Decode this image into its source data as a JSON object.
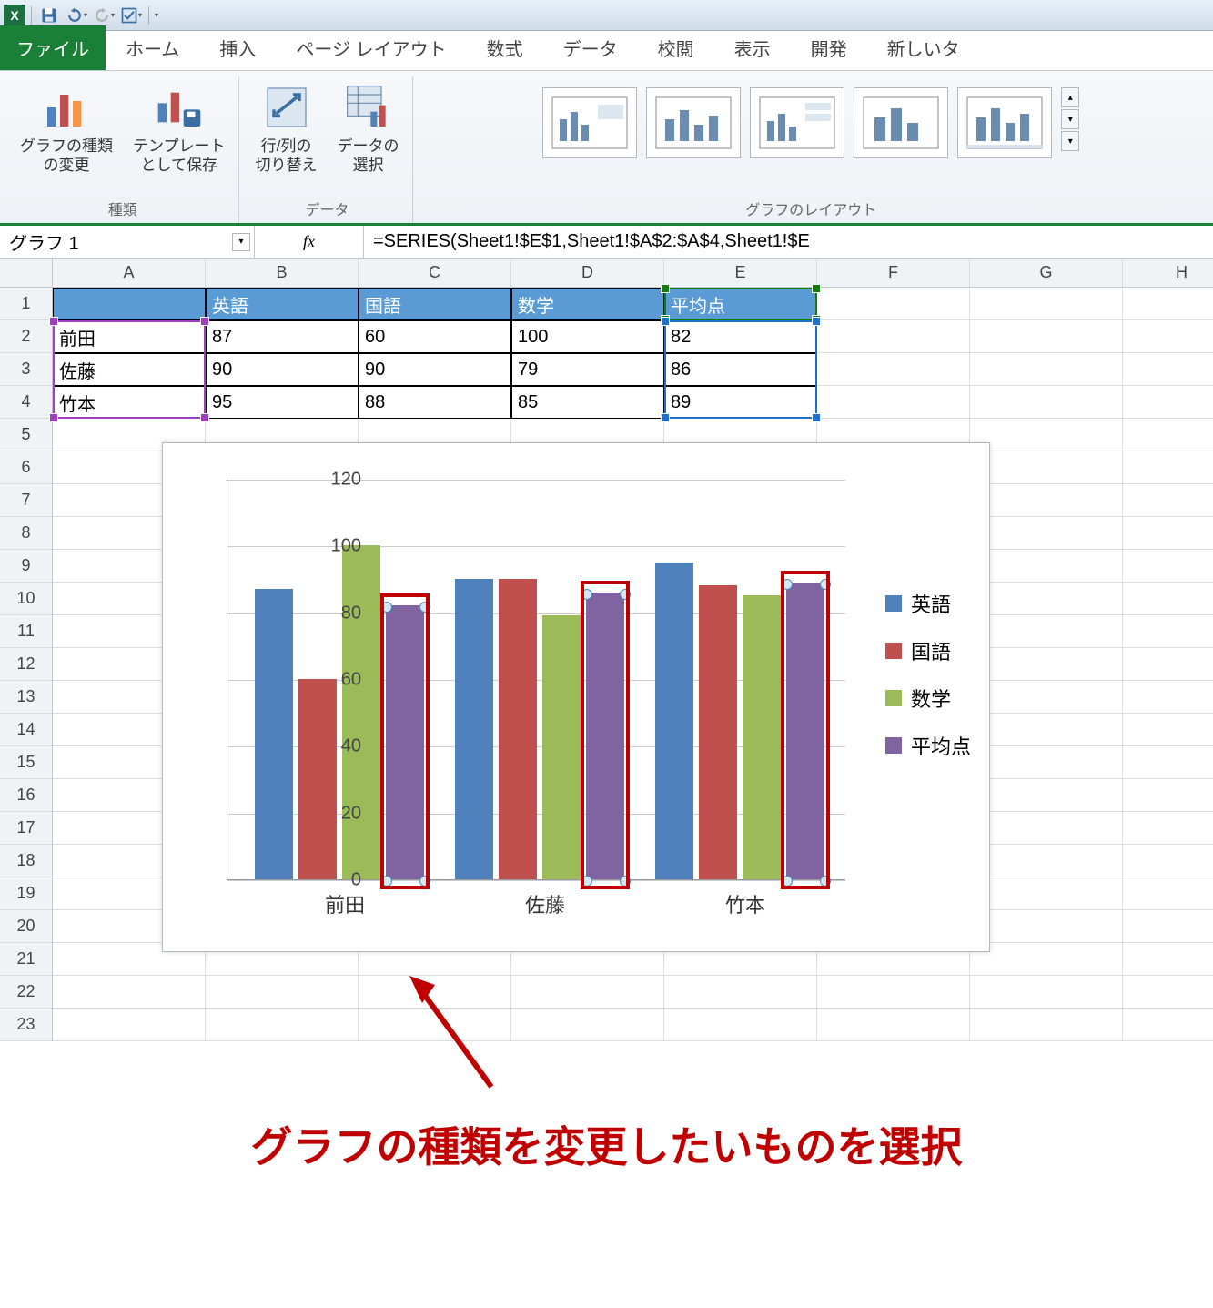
{
  "qat": {
    "excel": "X"
  },
  "tabs": {
    "file": "ファイル",
    "items": [
      "ホーム",
      "挿入",
      "ページ レイアウト",
      "数式",
      "データ",
      "校閲",
      "表示",
      "開発",
      "新しいタ"
    ]
  },
  "ribbon": {
    "group1": {
      "label": "種類",
      "btn1": "グラフの種類\nの変更",
      "btn2": "テンプレート\nとして保存"
    },
    "group2": {
      "label": "データ",
      "btn1": "行/列の\n切り替え",
      "btn2": "データの\n選択"
    },
    "group3": {
      "label": "グラフのレイアウト"
    }
  },
  "namebox": "グラフ 1",
  "formula": "=SERIES(Sheet1!$E$1,Sheet1!$A$2:$A$4,Sheet1!$E",
  "columns": [
    "A",
    "B",
    "C",
    "D",
    "E",
    "F",
    "G",
    "H"
  ],
  "rows": [
    "1",
    "2",
    "3",
    "4",
    "5",
    "6",
    "7",
    "8",
    "9",
    "10",
    "11",
    "12",
    "13",
    "14",
    "15",
    "16",
    "17",
    "18",
    "19",
    "20",
    "21",
    "22",
    "23"
  ],
  "table": {
    "headers": [
      "",
      "英語",
      "国語",
      "数学",
      "平均点"
    ],
    "data": [
      [
        "前田",
        "87",
        "60",
        "100",
        "82"
      ],
      [
        "佐藤",
        "90",
        "90",
        "79",
        "86"
      ],
      [
        "竹本",
        "95",
        "88",
        "85",
        "89"
      ]
    ]
  },
  "chart_data": {
    "type": "bar",
    "categories": [
      "前田",
      "佐藤",
      "竹本"
    ],
    "series": [
      {
        "name": "英語",
        "values": [
          87,
          90,
          95
        ],
        "color": "#4f81bd"
      },
      {
        "name": "国語",
        "values": [
          60,
          90,
          88
        ],
        "color": "#c0504d"
      },
      {
        "name": "数学",
        "values": [
          100,
          79,
          85
        ],
        "color": "#9bbb59"
      },
      {
        "name": "平均点",
        "values": [
          82,
          86,
          89
        ],
        "color": "#8064a2"
      }
    ],
    "ylim": [
      0,
      120
    ],
    "yticks": [
      0,
      20,
      40,
      60,
      80,
      100,
      120
    ],
    "selected_series": 3
  },
  "annotation": "グラフの種類を変更したいものを選択",
  "colwidths": {
    "A": 168,
    "B": 168,
    "C": 168,
    "D": 168,
    "E": 168,
    "F": 168,
    "G": 168,
    "H": 130
  }
}
